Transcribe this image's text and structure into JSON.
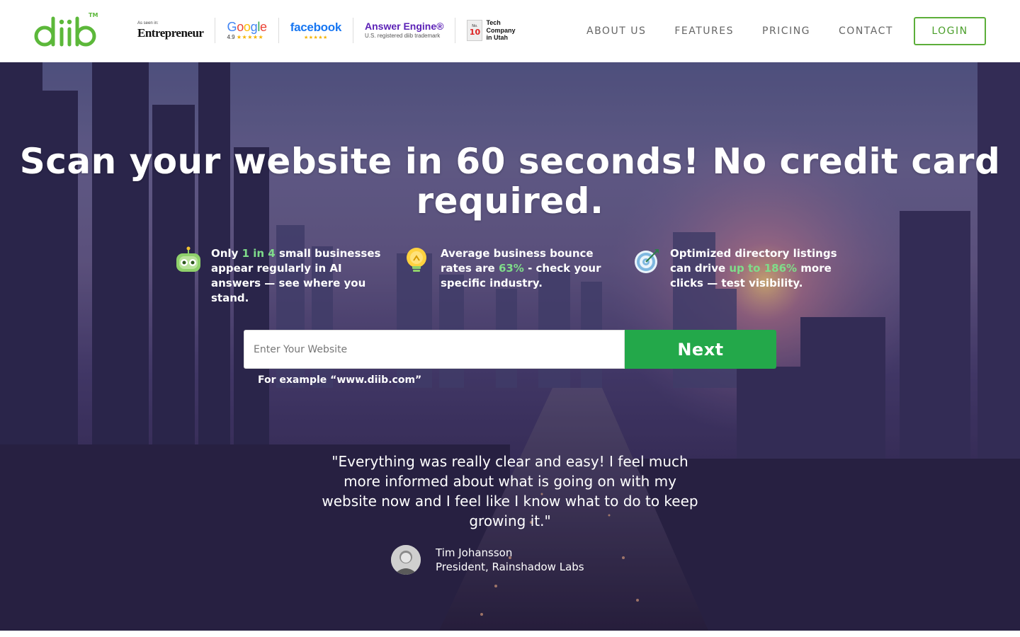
{
  "brand": {
    "logo_text": "diib",
    "trademark": "TM",
    "logo_color": "#5cb83a"
  },
  "badges": {
    "entrepreneur": {
      "small": "As seen in:",
      "name": "Entrepreneur"
    },
    "google": {
      "name": "Google",
      "rating": "4.9",
      "stars": "★★★★★"
    },
    "facebook": {
      "name": "facebook",
      "stars": "★★★★★"
    },
    "answer_engine": {
      "name": "Answer Engine®",
      "sub": "U.S. registered diib trademark"
    },
    "tech_company": {
      "no": "No.",
      "num": "10",
      "text": "Tech Company in Utah"
    }
  },
  "nav": {
    "items": [
      {
        "label": "ABOUT US"
      },
      {
        "label": "FEATURES"
      },
      {
        "label": "PRICING"
      },
      {
        "label": "CONTACT"
      }
    ],
    "login_label": "LOGIN"
  },
  "hero": {
    "headline": "Scan your website in 60 seconds! No credit card required.",
    "stats": [
      {
        "icon": "robot-icon",
        "before": "Only ",
        "highlight": "1 in 4",
        "after": " small businesses appear regularly in AI answers — see where you stand."
      },
      {
        "icon": "lightbulb-icon",
        "before": "Average business bounce rates are ",
        "highlight": "63%",
        "after": " - check your specific industry."
      },
      {
        "icon": "target-icon",
        "before": "Optimized directory listings can drive ",
        "highlight": "up to 186%",
        "after": " more clicks — test visibility."
      }
    ],
    "input_placeholder": "Enter Your Website",
    "next_label": "Next",
    "example": "For example “www.diib.com”",
    "quote": "\"Everything was really clear and easy! I feel much more informed about what is going on with my website now and I feel like I know what to do to keep growing it.\"",
    "author_name": "Tim Johansson",
    "author_title": "President, Rainshadow Labs"
  },
  "colors": {
    "accent_green": "#23a84a",
    "highlight_green": "#7fdc8a",
    "login_border": "#5cae3a"
  }
}
